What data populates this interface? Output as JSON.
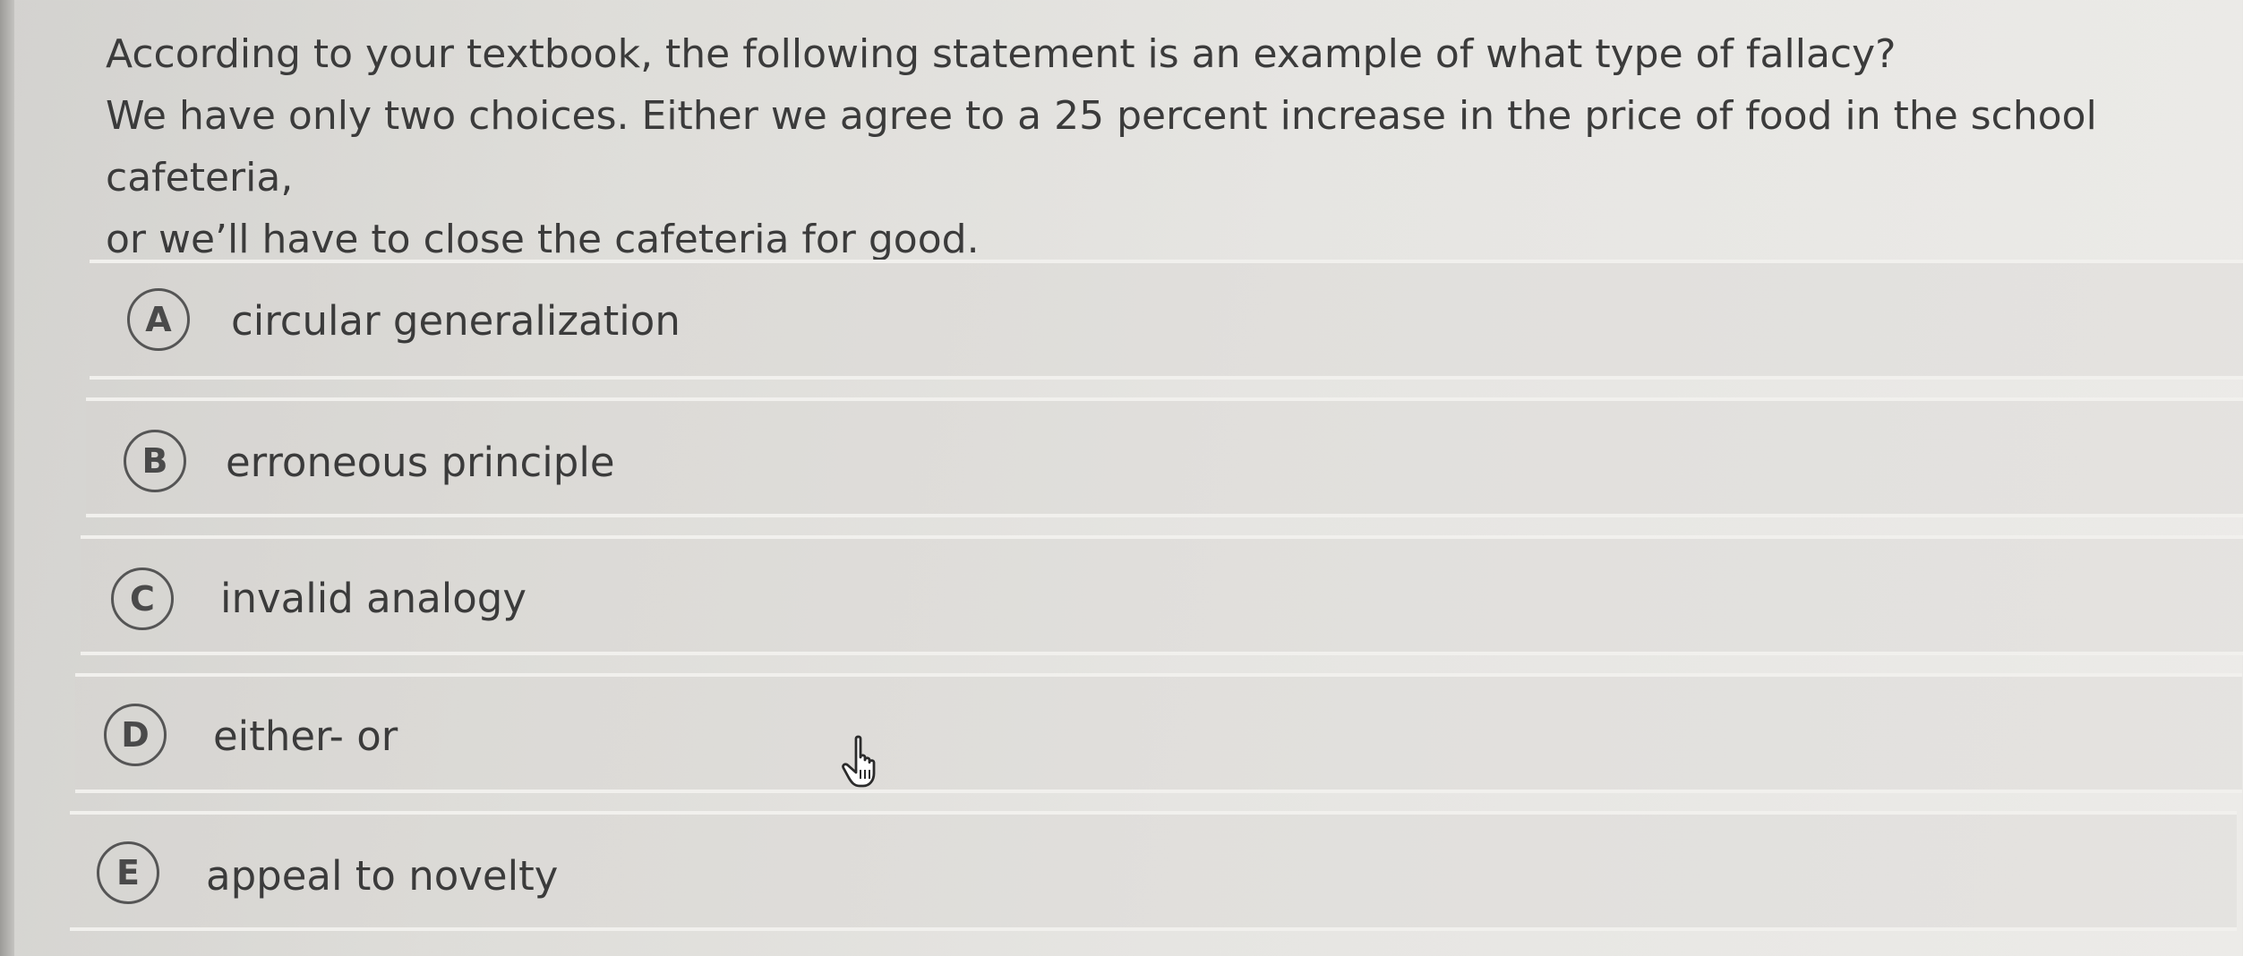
{
  "question": {
    "prompt": "According to your textbook, the following statement is an example of what type of fallacy?",
    "statement_line1": "We have only two choices. Either we agree to a 25 percent increase in the price of food in the school cafeteria,",
    "statement_line2": "or we’ll have to close the cafeteria for good."
  },
  "options": [
    {
      "letter": "A",
      "label": "circular generalization"
    },
    {
      "letter": "B",
      "label": "erroneous principle"
    },
    {
      "letter": "C",
      "label": "invalid analogy"
    },
    {
      "letter": "D",
      "label": "either- or"
    },
    {
      "letter": "E",
      "label": "appeal to novelty"
    }
  ],
  "cursor": {
    "icon": "pointer-hand-icon"
  },
  "colors": {
    "text": "#3b3b3b",
    "background": "#e4e3df",
    "row_divider": "#f1f0ed"
  }
}
